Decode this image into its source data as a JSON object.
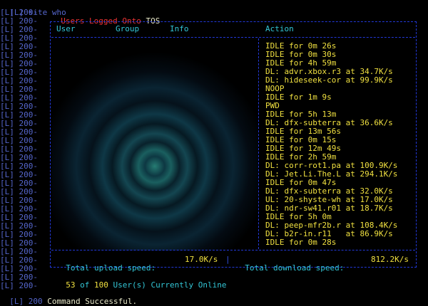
{
  "prompt_line": {
    "prefix": "[L]",
    "command": "site who"
  },
  "line_prefix": "[L] 200-",
  "title": {
    "left": "Users Logged Onto",
    "right": "TOS"
  },
  "table": {
    "headers": [
      "User",
      "Group",
      "Info",
      "Action"
    ],
    "actions": [
      "IDLE for 0m 26s",
      "IDLE for 0m 30s",
      "IDLE for 4h 59m",
      "DL: advr.xbox.r3 at 34.7K/s",
      "DL: hideseek-cor at 99.9K/s",
      "NOOP",
      "IDLE for 1m 9s",
      "PWD",
      "IDLE for 5h 13m",
      "DL: dfx-subterra at 36.6K/s",
      "IDLE for 13m 56s",
      "IDLE for 0m 15s",
      "IDLE for 12m 49s",
      "IDLE for 2h 59m",
      "DL: corr-rot1.pa at 100.9K/s",
      "DL: Jet.Li.The.L at 294.1K/s",
      "IDLE for 0m 47s",
      "DL: dfx-subterra at 32.0K/s",
      "UL: 20-shyste-wh at 17.0K/s",
      "DL: ndr-sw41.r01 at 18.7K/s",
      "IDLE for 5h 0m",
      "DL: peep-mfr2b.r at 108.4K/s",
      "DL: b2r-in.r11   at 86.9K/s",
      "IDLE for 0m 28s"
    ]
  },
  "totals": {
    "upload_label": "Total upload speed:",
    "upload_value": "17.0K/s",
    "download_label": "Total download speed:",
    "download_value": "812.2K/s"
  },
  "online": {
    "count": "53",
    "of": "of",
    "max": "100",
    "text": "User(s) Currently Online"
  },
  "footer": {
    "prefix": "[L] 200",
    "text": "Command Successful."
  },
  "colors": {
    "accent_yellow": "#f0e040",
    "title_red": "#ee3333",
    "header_cyan": "#33c6d6",
    "border_blue": "#2238d8"
  }
}
